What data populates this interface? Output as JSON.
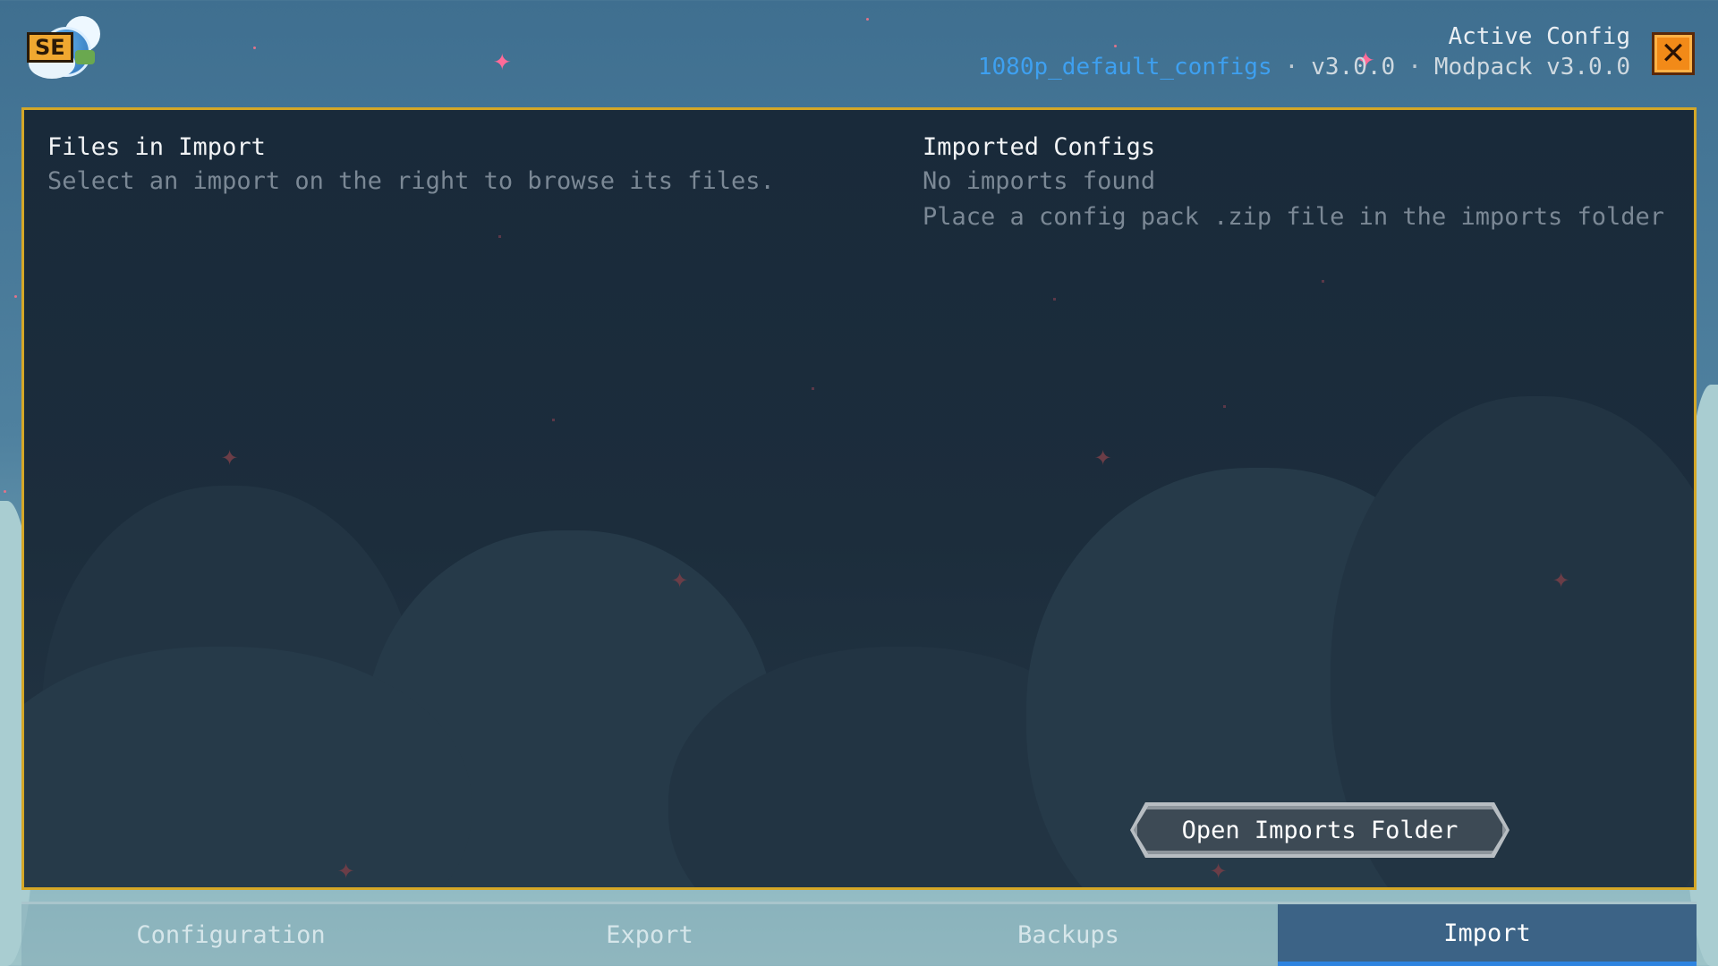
{
  "header": {
    "logo_icon": "se-globe-logo-icon",
    "logo_badge": "SE",
    "active_config_title": "Active Config",
    "config_name": "1080p_default_configs",
    "separator": "·",
    "config_version": "v3.0.0",
    "modpack_version": "Modpack v3.0.0",
    "close_icon": "close-icon",
    "close_glyph": "✕"
  },
  "panel": {
    "left": {
      "title": "Files in Import",
      "hint": "Select an import on the right to browse its files."
    },
    "right": {
      "title": "Imported Configs",
      "empty_message": "No imports found",
      "empty_hint": "Place a config pack .zip file in the imports folder"
    },
    "open_imports_label": "Open Imports Folder"
  },
  "tabs": [
    {
      "label": "Configuration",
      "active": false
    },
    {
      "label": "Export",
      "active": false
    },
    {
      "label": "Backups",
      "active": false
    },
    {
      "label": "Import",
      "active": true
    }
  ],
  "colors": {
    "accent_border": "#d4a728",
    "config_name": "#3ea0f0",
    "active_tab_underline": "#2e84e0",
    "close_button": "#f28a18"
  }
}
